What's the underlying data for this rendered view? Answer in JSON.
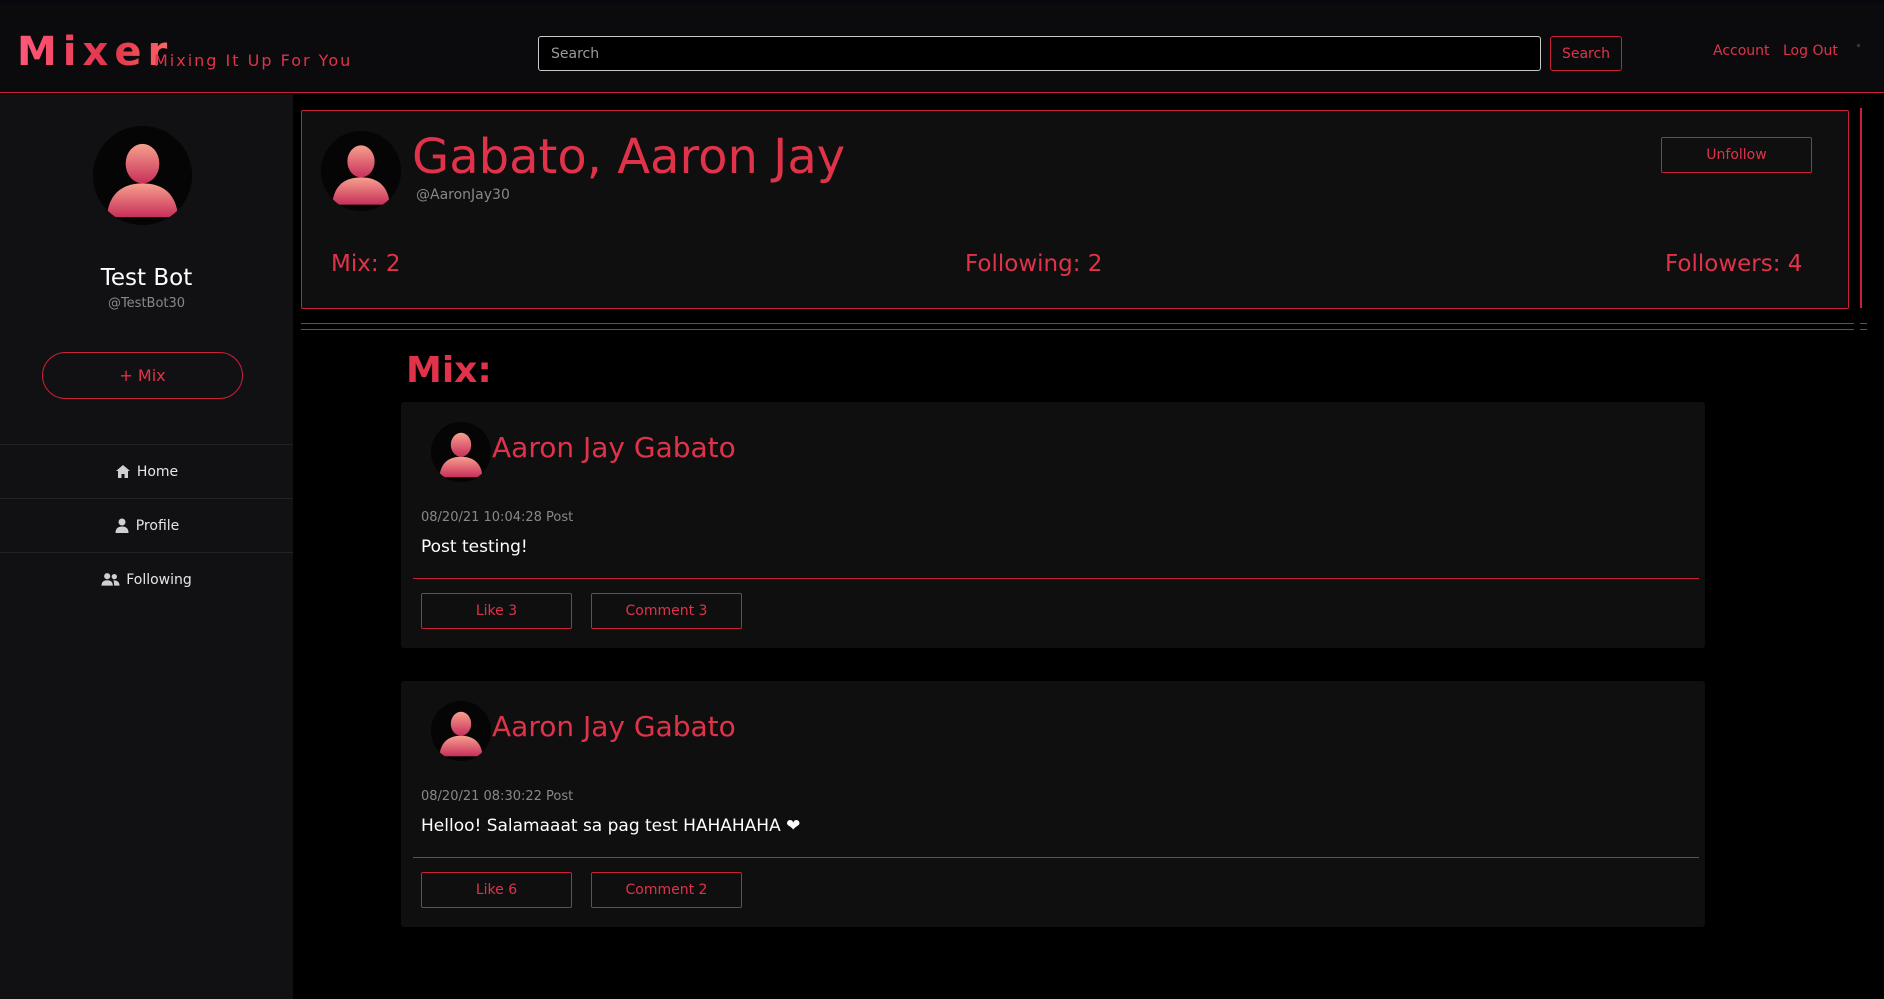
{
  "header": {
    "brand": "Mixer",
    "tagline": "Mixing It Up For You",
    "search_placeholder": "Search",
    "search_button": "Search",
    "account_link": "Account",
    "logout_link": "Log Out"
  },
  "sidebar": {
    "user_name": "Test Bot",
    "user_handle": "@TestBot30",
    "mix_button": "+ Mix",
    "items": [
      {
        "label": "Home",
        "icon": "home-icon"
      },
      {
        "label": "Profile",
        "icon": "user-icon"
      },
      {
        "label": "Following",
        "icon": "users-icon"
      }
    ]
  },
  "profile": {
    "name": "Gabato, Aaron Jay",
    "handle": "@AaronJay30",
    "unfollow_button": "Unfollow",
    "stats": {
      "mix": "Mix: 2",
      "following": "Following: 2",
      "followers": "Followers: 4"
    }
  },
  "feed": {
    "heading": "Mix:",
    "posts": [
      {
        "author": "Aaron Jay Gabato",
        "meta": "08/20/21 10:04:28 Post",
        "body": "Post testing!",
        "like": "Like 3",
        "comment": "Comment 3"
      },
      {
        "author": "Aaron Jay Gabato",
        "meta": "08/20/21 08:30:22 Post",
        "body": "Helloo! Salamaaat sa pag test HAHAHAHA ❤",
        "like": "Like 6",
        "comment": "Comment 2"
      }
    ]
  },
  "colors": {
    "accent": "#e0334a",
    "background": "#000000",
    "panel": "#0f0f10",
    "sidebar": "#111113"
  }
}
